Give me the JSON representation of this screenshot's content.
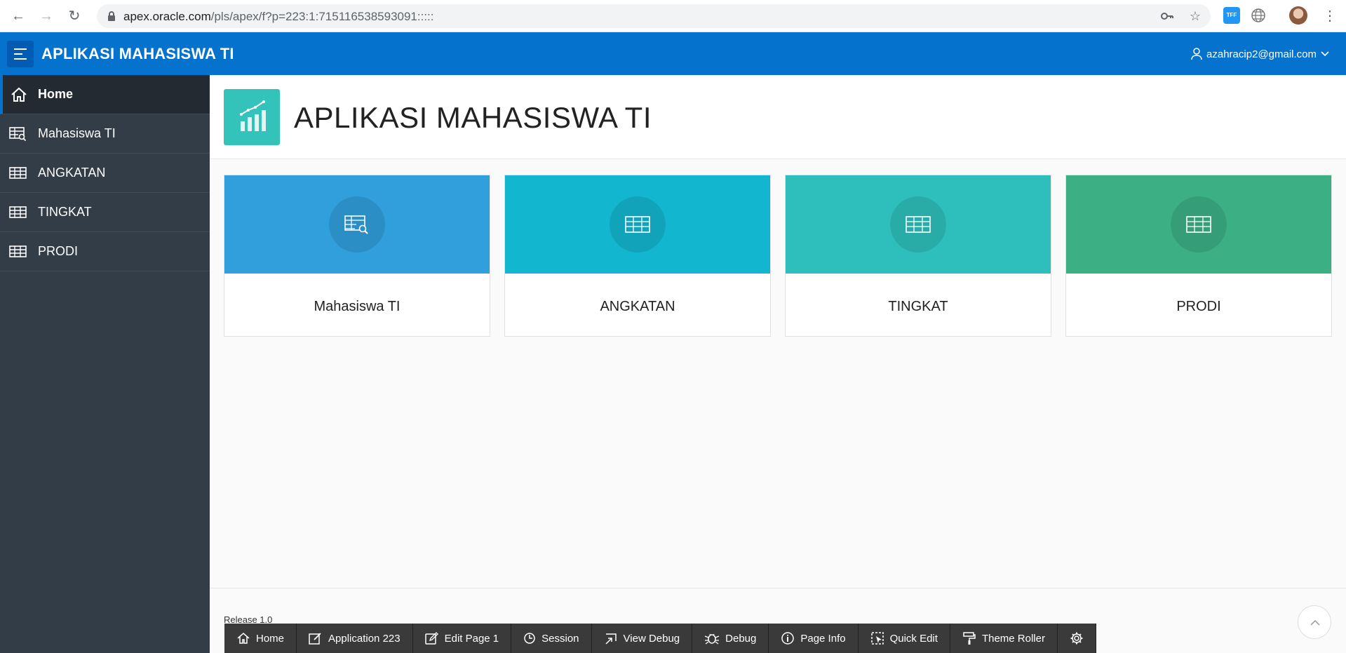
{
  "browser": {
    "url_host": "apex.oracle.com",
    "url_path": "/pls/apex/f?p=223:1:715116538593091:::::",
    "ext_label": "TFF"
  },
  "header": {
    "app_title": "APLIKASI MAHASISWA TI",
    "user": "azahracip2@gmail.com",
    "brand_color": "#0572ce"
  },
  "sidebar": {
    "items": [
      {
        "label": "Home",
        "icon": "home-icon"
      },
      {
        "label": "Mahasiswa TI",
        "icon": "table-search-icon"
      },
      {
        "label": "ANGKATAN",
        "icon": "table-icon"
      },
      {
        "label": "TINGKAT",
        "icon": "table-icon"
      },
      {
        "label": "PRODI",
        "icon": "table-icon"
      }
    ]
  },
  "hero": {
    "title": "APLIKASI MAHASISWA TI",
    "icon": "chart-icon"
  },
  "cards": [
    {
      "label": "Mahasiswa TI",
      "color": "#309fdb",
      "icon": "table-search-icon"
    },
    {
      "label": "ANGKATAN",
      "color": "#13b6cf",
      "icon": "table-icon"
    },
    {
      "label": "TINGKAT",
      "color": "#2ebfbc",
      "icon": "table-icon"
    },
    {
      "label": "PRODI",
      "color": "#3caf85",
      "icon": "table-icon"
    }
  ],
  "footer": {
    "release": "Release 1.0"
  },
  "devbar": {
    "home": "Home",
    "application": "Application 223",
    "edit_page": "Edit Page 1",
    "session": "Session",
    "view_debug": "View Debug",
    "debug": "Debug",
    "page_info": "Page Info",
    "quick_edit": "Quick Edit",
    "theme_roller": "Theme Roller"
  }
}
